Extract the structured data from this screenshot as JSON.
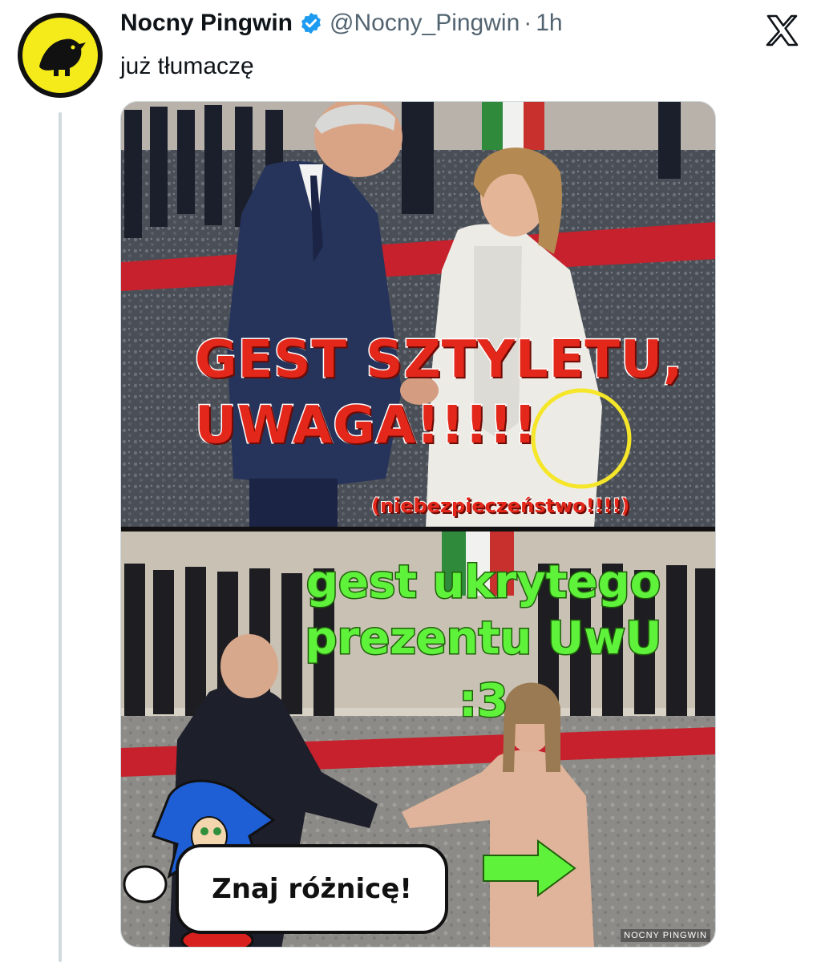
{
  "author": {
    "display_name": "Nocny Pingwin",
    "handle": "@Nocny_Pingwin",
    "separator": "·",
    "time": "1h",
    "verified": true
  },
  "tweet": {
    "text": "już tłumaczę"
  },
  "meme": {
    "top_caption_line1": "GEST SZTYLETU,",
    "top_caption_line2": "UWAGA!!!!!",
    "top_caption_small": "(niebezpieczeństwo!!!!)",
    "bottom_caption_line1": "gest ukrytego",
    "bottom_caption_line2": "prezentu UwU",
    "bottom_caption_line3": ":3",
    "speech_bubble": "Znaj różnicę!",
    "watermark": "NOCNY PINGWIN"
  },
  "colors": {
    "name": "#0f1419",
    "secondary": "#536471",
    "verified_badge": "#1d9bf0",
    "thread_line": "#cfd9de",
    "meme_red": "#e3281b",
    "meme_green": "#5ff23b",
    "circle_yellow": "#f5e62a"
  },
  "icons": {
    "verified": "verified-badge-icon",
    "platform": "x-logo-icon",
    "avatar": "penguin-avatar"
  }
}
